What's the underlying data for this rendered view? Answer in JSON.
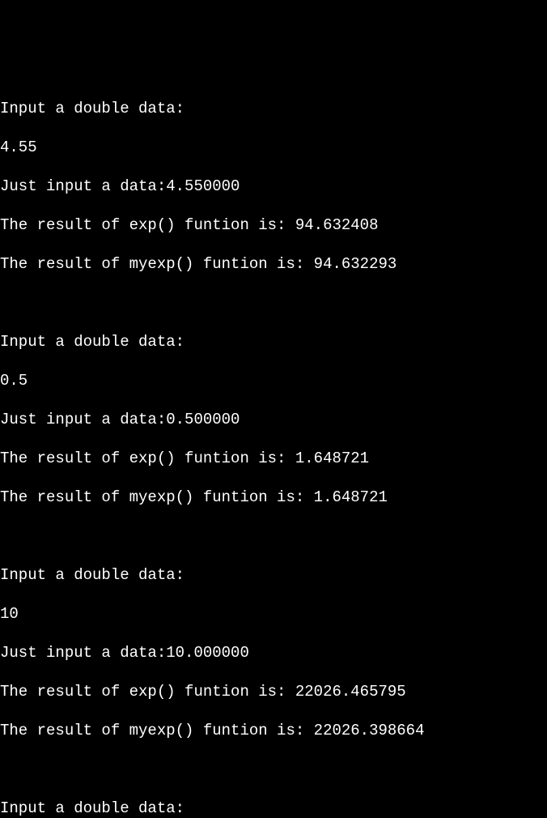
{
  "lines": {
    "l0": "Input a double data:",
    "l1": "4.55",
    "l2": "Just input a data:4.550000",
    "l3": "The result of exp() funtion is: 94.632408",
    "l4": "The result of myexp() funtion is: 94.632293",
    "l5": "",
    "l6": "Input a double data:",
    "l7": "0.5",
    "l8": "Just input a data:0.500000",
    "l9": "The result of exp() funtion is: 1.648721",
    "l10": "The result of myexp() funtion is: 1.648721",
    "l11": "",
    "l12": "Input a double data:",
    "l13": "10",
    "l14": "Just input a data:10.000000",
    "l15": "The result of exp() funtion is: 22026.465795",
    "l16": "The result of myexp() funtion is: 22026.398664",
    "l17": "",
    "l18": "Input a double data:"
  }
}
